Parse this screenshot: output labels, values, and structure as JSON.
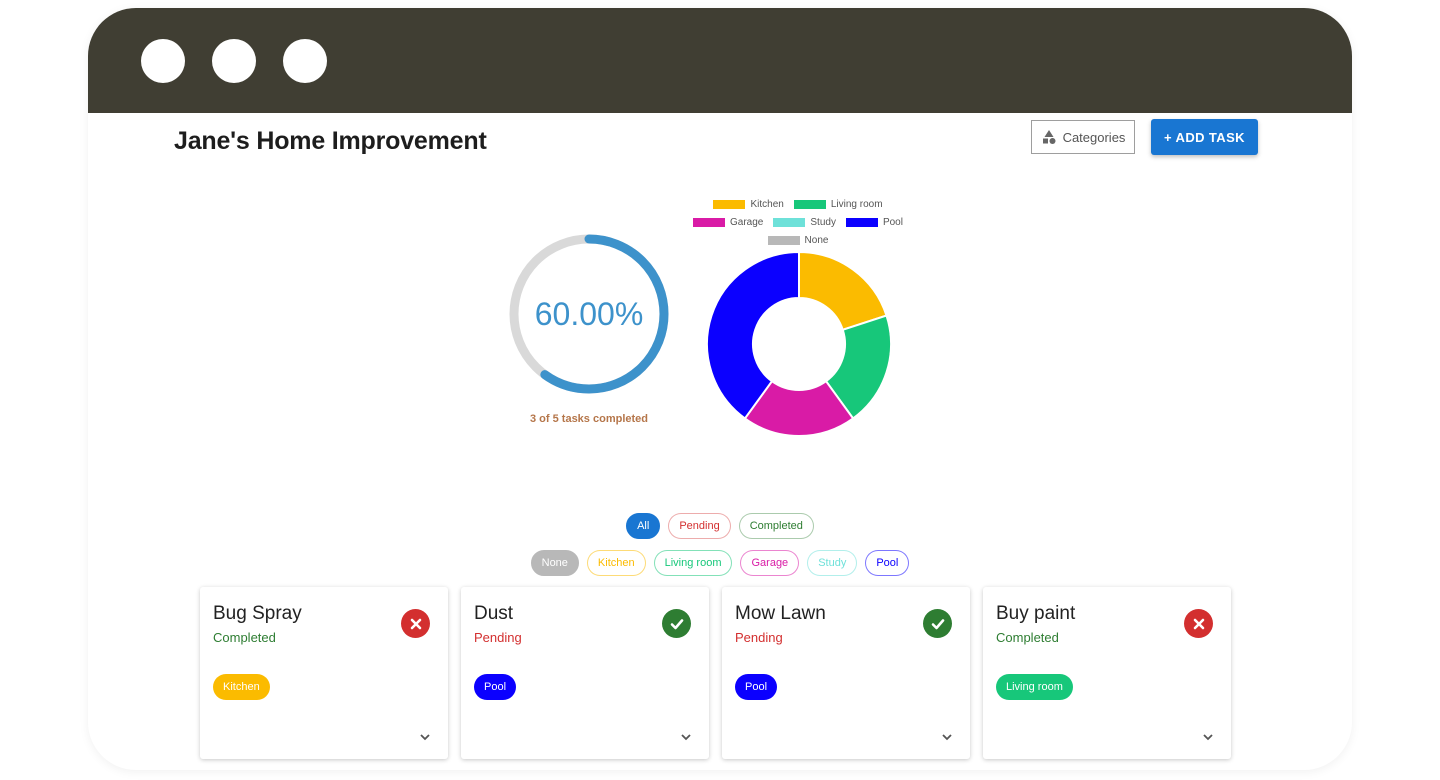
{
  "app": {
    "title": "Jane's Home Improvement"
  },
  "toolbar": {
    "categories_label": "Categories",
    "add_task_label": "+ ADD TASK"
  },
  "progress": {
    "value_text": "60.00%",
    "fraction": 0.6,
    "caption": "3 of 5 tasks completed",
    "color": "#3d92cb",
    "track_color": "#d9d9d9"
  },
  "chart_data": {
    "type": "pie",
    "legend_position": "top",
    "legend": [
      "Kitchen",
      "Living room",
      "Garage",
      "Study",
      "Pool",
      "None"
    ],
    "colors": {
      "Kitchen": "#fbbb00",
      "Living room": "#17c77a",
      "Garage": "#d91ba6",
      "Study": "#6ee1d9",
      "Pool": "#0b00ff",
      "None": "#b8b8b8"
    },
    "values": [
      1,
      1,
      1,
      0,
      2,
      0
    ]
  },
  "filters": {
    "status": [
      {
        "label": "All",
        "active": true,
        "color": "#1976d2"
      },
      {
        "label": "Pending",
        "active": false,
        "color": "#d32f2f"
      },
      {
        "label": "Completed",
        "active": false,
        "color": "#2e7d32"
      }
    ],
    "categories": [
      {
        "label": "None",
        "color": "#b8b8b8",
        "filled": true
      },
      {
        "label": "Kitchen",
        "color": "#fbbb00",
        "filled": false
      },
      {
        "label": "Living room",
        "color": "#17c77a",
        "filled": false
      },
      {
        "label": "Garage",
        "color": "#d91ba6",
        "filled": false
      },
      {
        "label": "Study",
        "color": "#6ee1d9",
        "filled": false
      },
      {
        "label": "Pool",
        "color": "#0b00ff",
        "filled": false
      }
    ]
  },
  "tasks": [
    {
      "title": "Bug Spray",
      "status": "Completed",
      "status_color": "#2e7d32",
      "icon": "cancel-icon",
      "icon_color": "#d32f2f",
      "tag": "Kitchen",
      "tag_color": "#fbbb00"
    },
    {
      "title": "Dust",
      "status": "Pending",
      "status_color": "#d32f2f",
      "icon": "check-circle-icon",
      "icon_color": "#2e7d32",
      "tag": "Pool",
      "tag_color": "#0b00ff"
    },
    {
      "title": "Mow Lawn",
      "status": "Pending",
      "status_color": "#d32f2f",
      "icon": "check-circle-icon",
      "icon_color": "#2e7d32",
      "tag": "Pool",
      "tag_color": "#0b00ff"
    },
    {
      "title": "Buy paint",
      "status": "Completed",
      "status_color": "#2e7d32",
      "icon": "cancel-icon",
      "icon_color": "#d32f2f",
      "tag": "Living room",
      "tag_color": "#17c77a"
    }
  ]
}
